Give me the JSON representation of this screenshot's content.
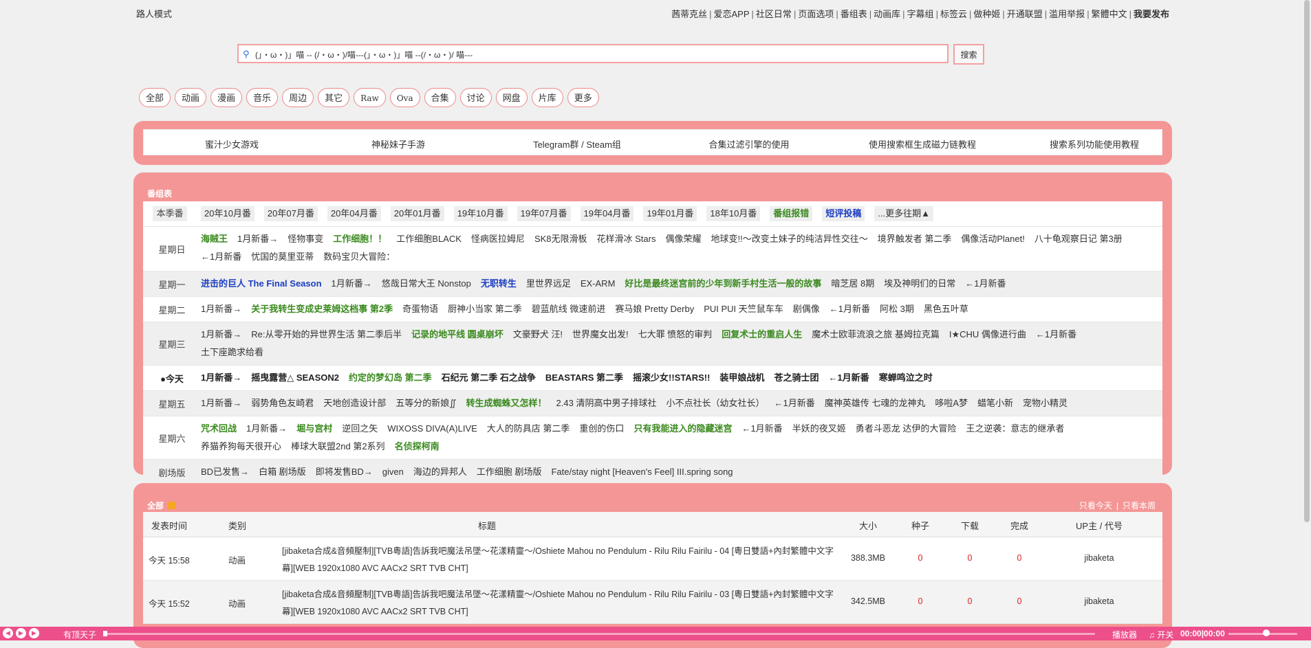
{
  "top": {
    "mode": "路人模式",
    "nav": [
      "茜蒂克丝",
      "爱恋APP",
      "社区日常",
      "页面选项",
      "番组表",
      "动画库",
      "字幕组",
      "标签云",
      "做种姬",
      "开通联盟",
      "滥用举报",
      "繁體中文",
      "我要发布"
    ]
  },
  "search": {
    "query": "(」・ω・)」喵 -- (/・ω・)/喵---(」・ω・)」喵 --(/・ω・)/ 喵---",
    "button": "搜索"
  },
  "categories": [
    "全部",
    "动画",
    "漫画",
    "音乐",
    "周边",
    "其它",
    "Raw",
    "Ova",
    "合集",
    "讨论",
    "网盘",
    "片库",
    "更多"
  ],
  "links": [
    "蜜汁少女游戏",
    "神秘妹子手游",
    "Telegram群 / Steam组",
    "合集过滤引擎的使用",
    "使用搜索框生成磁力链教程",
    "搜索系列功能使用教程"
  ],
  "schedule": {
    "title": "番组表",
    "header": {
      "label": "本季番",
      "tabs": [
        "20年10月番",
        "20年07月番",
        "20年04月番",
        "20年01月番",
        "19年10月番",
        "19年07月番",
        "19年04月番",
        "19年01月番",
        "18年10月番"
      ],
      "green_link": "番组报错",
      "blue_link": "短评投稿",
      "more": "...更多往期▲"
    },
    "days": [
      {
        "day": "星期日",
        "items": [
          {
            "t": "海贼王",
            "c": "g"
          },
          {
            "t": "1月新番→",
            "c": ""
          },
          {
            "t": "怪物事变",
            "c": ""
          },
          {
            "t": "工作细胞！！",
            "c": "g"
          },
          {
            "t": "工作细胞BLACK",
            "c": ""
          },
          {
            "t": "怪病医拉姆尼",
            "c": ""
          },
          {
            "t": "SK8无限滑板",
            "c": ""
          },
          {
            "t": "花样滑冰 Stars",
            "c": ""
          },
          {
            "t": "偶像荣耀",
            "c": ""
          },
          {
            "t": "地球变!!～改变土妹子的纯洁异性交往～",
            "c": ""
          },
          {
            "t": "境界触发者 第二季",
            "c": ""
          },
          {
            "t": "偶像活动Planet!",
            "c": ""
          },
          {
            "t": "八十龟观察日记 第3册",
            "c": ""
          },
          {
            "t": "←1月新番",
            "c": ""
          },
          {
            "t": "忧国的莫里亚蒂",
            "c": ""
          },
          {
            "t": "数码宝贝大冒险：",
            "c": ""
          }
        ]
      },
      {
        "day": "星期一",
        "items": [
          {
            "t": "进击的巨人 The Final Season",
            "c": "b"
          },
          {
            "t": "1月新番→",
            "c": ""
          },
          {
            "t": "悠哉日常大王 Nonstop",
            "c": ""
          },
          {
            "t": "无职转生",
            "c": "b"
          },
          {
            "t": "里世界远足",
            "c": ""
          },
          {
            "t": "EX-ARM",
            "c": ""
          },
          {
            "t": "好比是最终迷宫前的少年到新手村生活一般的故事",
            "c": "g"
          },
          {
            "t": "暗芝居 8期",
            "c": ""
          },
          {
            "t": "埃及神明们的日常",
            "c": ""
          },
          {
            "t": "←1月新番",
            "c": ""
          }
        ]
      },
      {
        "day": "星期二",
        "items": [
          {
            "t": "1月新番→",
            "c": ""
          },
          {
            "t": "关于我转生变成史莱姆这档事 第2季",
            "c": "g"
          },
          {
            "t": "奇蛋物语",
            "c": ""
          },
          {
            "t": "厨神小当家 第二季",
            "c": ""
          },
          {
            "t": "碧蓝航线 微速前进",
            "c": ""
          },
          {
            "t": "赛马娘 Pretty Derby",
            "c": ""
          },
          {
            "t": "PUI PUI 天竺鼠车车",
            "c": ""
          },
          {
            "t": "剧偶像",
            "c": ""
          },
          {
            "t": "←1月新番",
            "c": ""
          },
          {
            "t": "阿松 3期",
            "c": ""
          },
          {
            "t": "黑色五叶草",
            "c": ""
          }
        ]
      },
      {
        "day": "星期三",
        "items": [
          {
            "t": "1月新番→",
            "c": ""
          },
          {
            "t": "Re:从零开始的异世界生活 第二季后半",
            "c": ""
          },
          {
            "t": "记录的地平线 圆桌崩坏",
            "c": "g"
          },
          {
            "t": "文豪野犬 汪!",
            "c": ""
          },
          {
            "t": "世界魔女出发!",
            "c": ""
          },
          {
            "t": "七大罪 愤怒的审判",
            "c": ""
          },
          {
            "t": "回复术士的重启人生",
            "c": "g"
          },
          {
            "t": "魔术士欧菲流浪之旅 基姆拉克篇",
            "c": ""
          },
          {
            "t": "I★CHU 偶像进行曲",
            "c": ""
          },
          {
            "t": "←1月新番",
            "c": ""
          },
          {
            "t": "土下座跪求给看",
            "c": ""
          }
        ]
      },
      {
        "day": "●今天",
        "today": true,
        "items": [
          {
            "t": "1月新番→",
            "c": "k"
          },
          {
            "t": "摇曳露营△ SEASON2",
            "c": "k"
          },
          {
            "t": "约定的梦幻岛 第二季",
            "c": "g"
          },
          {
            "t": "石纪元 第二季 石之战争",
            "c": "k"
          },
          {
            "t": "BEASTARS 第二季",
            "c": "k"
          },
          {
            "t": "摇滚少女!!STARS!!",
            "c": "k"
          },
          {
            "t": "装甲娘战机",
            "c": "k"
          },
          {
            "t": "苍之骑士团",
            "c": "k"
          },
          {
            "t": "←1月新番",
            "c": "k"
          },
          {
            "t": "寒蝉鸣泣之时",
            "c": "k"
          }
        ]
      },
      {
        "day": "星期五",
        "items": [
          {
            "t": "1月新番→",
            "c": ""
          },
          {
            "t": "弱势角色友崎君",
            "c": ""
          },
          {
            "t": "天地创造设计部",
            "c": ""
          },
          {
            "t": "五等分的新娘∬",
            "c": ""
          },
          {
            "t": "转生成蜘蛛又怎样！",
            "c": "g"
          },
          {
            "t": "2.43 清阴高中男子排球社",
            "c": ""
          },
          {
            "t": "小不点社长（幼女社长）",
            "c": ""
          },
          {
            "t": "←1月新番",
            "c": ""
          },
          {
            "t": "魔神英雄传 七魂的龙神丸",
            "c": ""
          },
          {
            "t": "哆啦A梦",
            "c": ""
          },
          {
            "t": "蜡笔小新",
            "c": ""
          },
          {
            "t": "宠物小精灵",
            "c": ""
          }
        ]
      },
      {
        "day": "星期六",
        "items": [
          {
            "t": "咒术回战",
            "c": "g"
          },
          {
            "t": "1月新番→",
            "c": ""
          },
          {
            "t": "堀与宫村",
            "c": "g"
          },
          {
            "t": "逆回之矢",
            "c": ""
          },
          {
            "t": "WIXOSS DIVA(A)LIVE",
            "c": ""
          },
          {
            "t": "大人的防具店 第二季",
            "c": ""
          },
          {
            "t": "重创的伤口",
            "c": ""
          },
          {
            "t": "只有我能进入的隐藏迷宫",
            "c": "g"
          },
          {
            "t": "←1月新番",
            "c": ""
          },
          {
            "t": "半妖的夜叉姬",
            "c": ""
          },
          {
            "t": "勇者斗恶龙 达伊的大冒险",
            "c": ""
          },
          {
            "t": "王之逆袭：意志的继承者",
            "c": ""
          },
          {
            "t": "养猫养狗每天很开心",
            "c": ""
          },
          {
            "t": "棒球大联盟2nd 第2系列",
            "c": ""
          },
          {
            "t": "名侦探柯南",
            "c": "g"
          }
        ]
      },
      {
        "day": "剧场版",
        "items": [
          {
            "t": "BD已发售→",
            "c": ""
          },
          {
            "t": "白箱 剧场版",
            "c": ""
          },
          {
            "t": "即将发售BD→",
            "c": ""
          },
          {
            "t": "given",
            "c": ""
          },
          {
            "t": "海边的异邦人",
            "c": ""
          },
          {
            "t": "工作细胞 剧场版",
            "c": ""
          },
          {
            "t": "Fate/stay night [Heaven's Feel] III.spring song",
            "c": ""
          }
        ]
      }
    ]
  },
  "list": {
    "title": "全部",
    "filters": [
      "只看今天",
      "只看本周"
    ],
    "columns": [
      "发表时间",
      "类别",
      "标题",
      "大小",
      "种子",
      "下载",
      "完成",
      "UP主 / 代号"
    ],
    "rows": [
      {
        "time": "今天 15:58",
        "cat": "动画",
        "title": "[jibaketa合成&音頻壓制][TVB粵語]告訴我吧魔法吊墜～花漾精靈～/Oshiete Mahou no Pendulum - Rilu Rilu Fairilu - 04 [粵日雙語+內封繁體中文字幕][WEB 1920x1080 AVC AACx2 SRT TVB CHT]",
        "size": "388.3MB",
        "seed": "0",
        "dl": "0",
        "done": "0",
        "up": "jibaketa"
      },
      {
        "time": "今天 15:52",
        "cat": "动画",
        "title": "[jibaketa合成&音頻壓制][TVB粵語]告訴我吧魔法吊墜～花漾精靈～/Oshiete Mahou no Pendulum - Rilu Rilu Fairilu - 03 [粵日雙語+內封繁體中文字幕][WEB 1920x1080 AVC AACx2 SRT TVB CHT]",
        "size": "342.5MB",
        "seed": "0",
        "dl": "0",
        "done": "0",
        "up": "jibaketa"
      }
    ]
  },
  "player": {
    "song": "有顶天子",
    "label": "播放器",
    "toggle": "开关",
    "time": "00:00|00:00"
  }
}
